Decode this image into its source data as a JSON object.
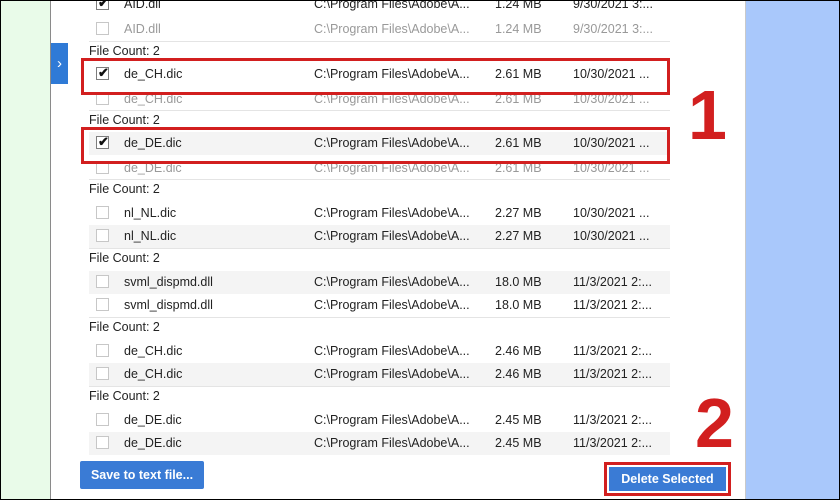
{
  "sidebar": {
    "expand_icon": "chevron-right-icon",
    "expand_glyph": "›"
  },
  "rows": [
    {
      "id": "r0",
      "name": "AID.dll",
      "path": "C:\\Program Files\\Adobe\\A...",
      "size": "1.24 MB",
      "date": "9/30/2021 3:...",
      "checked": true,
      "dim": false,
      "striped": false
    },
    {
      "id": "r1",
      "name": "AID.dll",
      "path": "C:\\Program Files\\Adobe\\A...",
      "size": "1.24 MB",
      "date": "9/30/2021 3:...",
      "checked": false,
      "dim": true,
      "striped": false
    },
    {
      "id": "r2",
      "name": "de_CH.dic",
      "path": "C:\\Program Files\\Adobe\\A...",
      "size": "2.61 MB",
      "date": "10/30/2021 ...",
      "checked": true,
      "dim": false,
      "striped": false
    },
    {
      "id": "r3",
      "name": "de_CH.dic",
      "path": "C:\\Program Files\\Adobe\\A...",
      "size": "2.61 MB",
      "date": "10/30/2021 ...",
      "checked": false,
      "dim": true,
      "striped": false
    },
    {
      "id": "r4",
      "name": "de_DE.dic",
      "path": "C:\\Program Files\\Adobe\\A...",
      "size": "2.61 MB",
      "date": "10/30/2021 ...",
      "checked": true,
      "dim": false,
      "striped": true
    },
    {
      "id": "r5",
      "name": "de_DE.dic",
      "path": "C:\\Program Files\\Adobe\\A...",
      "size": "2.61 MB",
      "date": "10/30/2021 ...",
      "checked": false,
      "dim": true,
      "striped": false
    },
    {
      "id": "r6",
      "name": "nl_NL.dic",
      "path": "C:\\Program Files\\Adobe\\A...",
      "size": "2.27 MB",
      "date": "10/30/2021 ...",
      "checked": false,
      "dim": false,
      "striped": false
    },
    {
      "id": "r7",
      "name": "nl_NL.dic",
      "path": "C:\\Program Files\\Adobe\\A...",
      "size": "2.27 MB",
      "date": "10/30/2021 ...",
      "checked": false,
      "dim": false,
      "striped": true
    },
    {
      "id": "r8",
      "name": "svml_dispmd.dll",
      "path": "C:\\Program Files\\Adobe\\A...",
      "size": "18.0 MB",
      "date": "11/3/2021 2:...",
      "checked": false,
      "dim": false,
      "striped": true
    },
    {
      "id": "r9",
      "name": "svml_dispmd.dll",
      "path": "C:\\Program Files\\Adobe\\A...",
      "size": "18.0 MB",
      "date": "11/3/2021 2:...",
      "checked": false,
      "dim": false,
      "striped": false
    },
    {
      "id": "r10",
      "name": "de_CH.dic",
      "path": "C:\\Program Files\\Adobe\\A...",
      "size": "2.46 MB",
      "date": "11/3/2021 2:...",
      "checked": false,
      "dim": false,
      "striped": false
    },
    {
      "id": "r11",
      "name": "de_CH.dic",
      "path": "C:\\Program Files\\Adobe\\A...",
      "size": "2.46 MB",
      "date": "11/3/2021 2:...",
      "checked": false,
      "dim": false,
      "striped": true
    },
    {
      "id": "r12",
      "name": "de_DE.dic",
      "path": "C:\\Program Files\\Adobe\\A...",
      "size": "2.45 MB",
      "date": "11/3/2021 2:...",
      "checked": false,
      "dim": false,
      "striped": false
    },
    {
      "id": "r13",
      "name": "de_DE.dic",
      "path": "C:\\Program Files\\Adobe\\A...",
      "size": "2.45 MB",
      "date": "11/3/2021 2:...",
      "checked": false,
      "dim": false,
      "striped": true
    }
  ],
  "group_labels": [
    {
      "id": "g0",
      "text": "File Count: 2"
    },
    {
      "id": "g1",
      "text": "File Count: 2"
    },
    {
      "id": "g2",
      "text": "File Count: 2"
    },
    {
      "id": "g3",
      "text": "File Count: 2"
    },
    {
      "id": "g4",
      "text": "File Count: 2"
    },
    {
      "id": "g5",
      "text": "File Count: 2"
    }
  ],
  "annotations": {
    "step1": "1",
    "step2": "2",
    "color": "#d21f1f"
  },
  "buttons": {
    "save_label": "Save to text file...",
    "delete_label": "Delete Selected",
    "button_color": "#3a7bd5"
  },
  "theme": {
    "left_strip": "#e9fbe9",
    "right_strip": "#a9c8fb",
    "check_glyph": "✔"
  }
}
